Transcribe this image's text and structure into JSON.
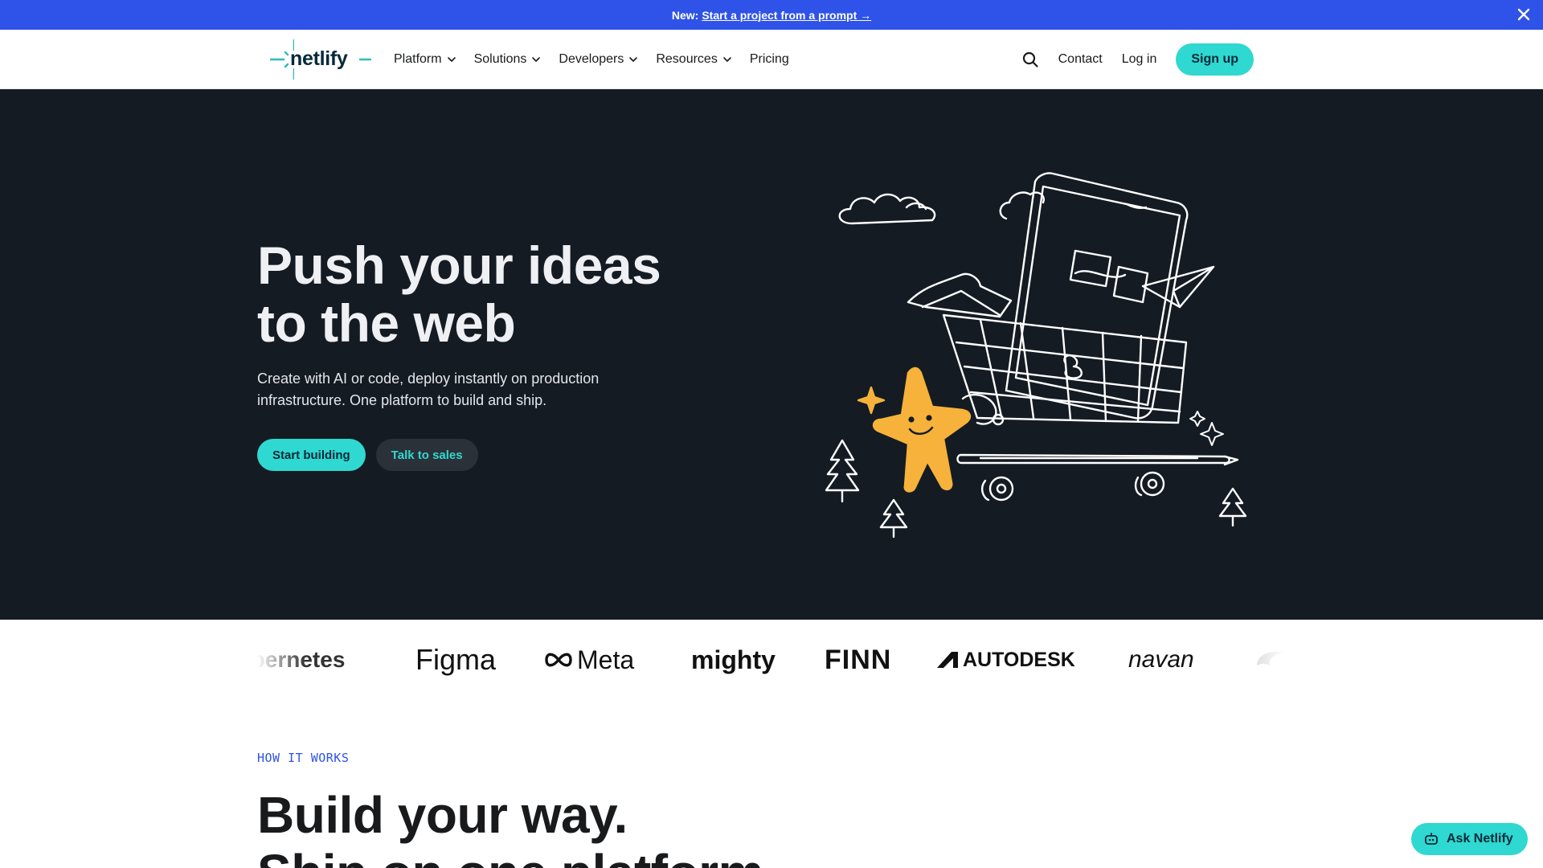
{
  "announcement": {
    "prefix": "New:",
    "link": "Start a project from a prompt →"
  },
  "nav": {
    "logo_text": "netlify",
    "menu": [
      {
        "label": "Platform",
        "has_dropdown": true
      },
      {
        "label": "Solutions",
        "has_dropdown": true
      },
      {
        "label": "Developers",
        "has_dropdown": true
      },
      {
        "label": "Resources",
        "has_dropdown": true
      },
      {
        "label": "Pricing",
        "has_dropdown": false
      }
    ],
    "contact": "Contact",
    "login": "Log in",
    "signup": "Sign up"
  },
  "hero": {
    "title_line1": "Push your ideas",
    "title_line2": "to the web",
    "lede_line1": "Create with AI or code, deploy instantly on production",
    "lede_line2": "infrastructure. One platform to build and ship.",
    "primary_cta": "Start building",
    "secondary_cta": "Talk to sales"
  },
  "logos": [
    "kubernetes",
    "Figma",
    "Meta",
    "mighty",
    "FINN",
    "AUTODESK",
    "navan"
  ],
  "how_it_works": {
    "eyebrow": "HOW IT WORKS",
    "title_line1": "Build your way.",
    "title_line2": "Ship on one platform."
  },
  "assistant": {
    "label": "Ask Netlify"
  },
  "colors": {
    "announcement_bg": "#2f53e8",
    "accent": "#2fd8d0",
    "hero_bg": "#141b23",
    "illustration_star": "#f6b23a"
  }
}
